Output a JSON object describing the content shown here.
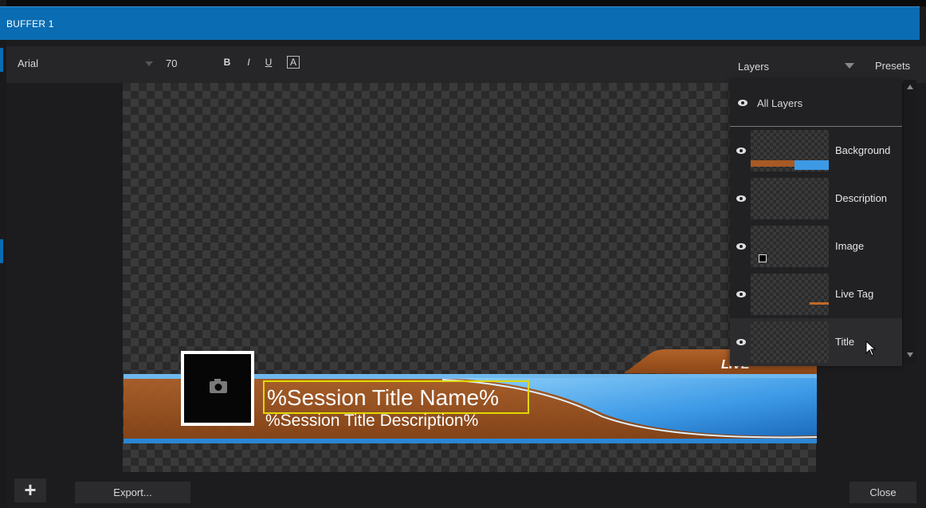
{
  "window": {
    "title": "BUFFER 1"
  },
  "toolbar": {
    "font_name": "Arial",
    "font_size": "70",
    "bold_label": "B",
    "italic_label": "I",
    "underline_label": "U",
    "outline_label": "A",
    "layers_label": "Layers",
    "presets_label": "Presets"
  },
  "layers_panel": {
    "all_layers_label": "All Layers",
    "items": [
      {
        "label": "Background"
      },
      {
        "label": "Description"
      },
      {
        "label": "Image"
      },
      {
        "label": "Live Tag"
      },
      {
        "label": "Title"
      }
    ],
    "selected": "Title"
  },
  "graphic": {
    "title_text": "%Session Title Name%",
    "description_text": "%Session Title Description%",
    "live_tag_text": "LIVE",
    "colors": {
      "orange": "#a85a24",
      "blue": "#2b86d6",
      "light_blue": "#7cc3f2",
      "selection": "#e0d800"
    }
  },
  "bottom": {
    "add_label": "+",
    "export_label": "Export...",
    "close_label": "Close"
  }
}
